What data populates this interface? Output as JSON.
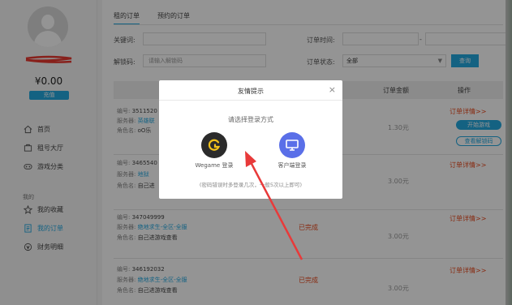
{
  "sidebar": {
    "balance": "¥0.00",
    "recharge_label": "充值",
    "nav": [
      {
        "label": "首页",
        "icon": "home-icon"
      },
      {
        "label": "租号大厅",
        "icon": "hall-icon"
      },
      {
        "label": "游戏分类",
        "icon": "category-icon"
      }
    ],
    "group_label": "我的",
    "my": [
      {
        "label": "我的收藏",
        "icon": "star-icon"
      },
      {
        "label": "我的订单",
        "icon": "order-icon"
      },
      {
        "label": "财务明细",
        "icon": "finance-icon"
      }
    ]
  },
  "main": {
    "tabs": [
      "租的订单",
      "预约的订单"
    ],
    "filters": {
      "keyword_label": "关键词:",
      "order_time_label": "订单时间:",
      "time_separator": "-",
      "unlock_code_label": "解锁码:",
      "unlock_code_placeholder": "请输入解锁码",
      "order_status_label": "订单状态:",
      "order_status_value": "全部",
      "query_label": "查询"
    },
    "columns": {
      "amount": "订单金额",
      "action": "操作"
    },
    "orders": [
      {
        "no_label": "编号:",
        "no": "3511520",
        "server_label": "服务器:",
        "server": "英雄联",
        "role_label": "角色名:",
        "role": "oO乐",
        "amount": "1.30元",
        "detail": "订单详情>>",
        "start_label": "开始游戏",
        "unlock_label": "查看解锁码"
      },
      {
        "no_label": "编号:",
        "no": "3465540",
        "server_label": "服务器:",
        "server": "地狱",
        "role_label": "角色名:",
        "role": "自己进",
        "amount": "3.00元",
        "detail": "订单详情>>"
      },
      {
        "no_label": "编号:",
        "no": "347049999",
        "server_label": "服务器:",
        "server": "绝地求生-全区-全服",
        "role_label": "角色名:",
        "role": "自己进游戏查看",
        "status": "已完成",
        "amount": "3.00元",
        "detail": "订单详情>>"
      },
      {
        "no_label": "编号:",
        "no": "346192032",
        "server_label": "服务器:",
        "server": "绝地求生-全区-全服",
        "role_label": "角色名:",
        "role": "自己进游戏查看",
        "status": "已完成",
        "amount": "3.00元",
        "detail": "订单详情>>"
      }
    ]
  },
  "dialog": {
    "title": "友情提示",
    "close": "×",
    "prompt": "请选择登录方式",
    "options": [
      {
        "label": "Wegame 登录",
        "icon": "wegame-icon",
        "color": "#2b2b2b"
      },
      {
        "label": "客户端登录",
        "icon": "monitor-icon",
        "color": "#5a6fe8"
      }
    ],
    "hint": "(密码错误时多登录几次，一般5次以上即可)"
  },
  "colors": {
    "accent": "#24a9e1",
    "warning": "#e8491d",
    "arrow": "#e83a3a"
  }
}
